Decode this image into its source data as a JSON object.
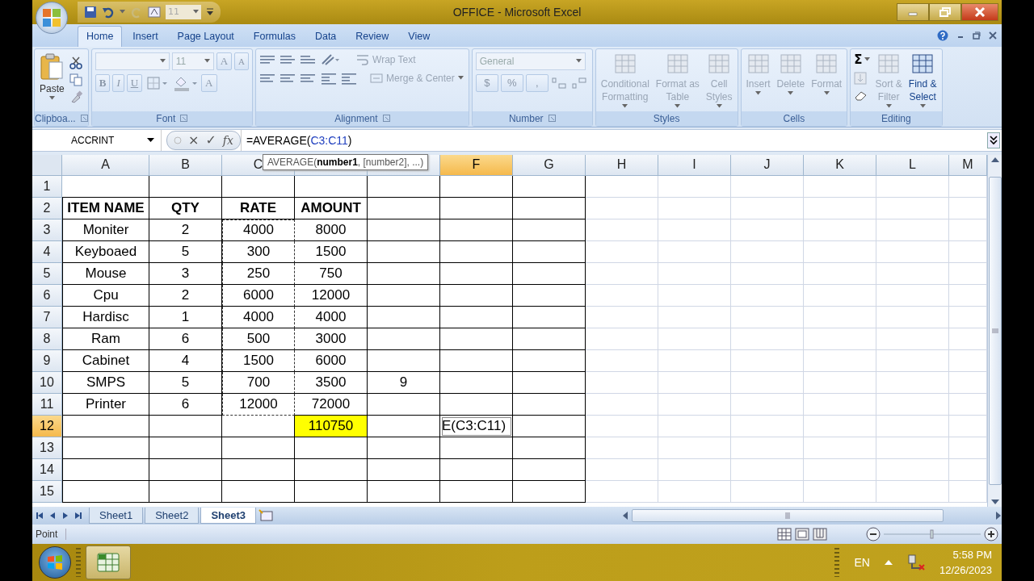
{
  "window": {
    "title": "OFFICE - Microsoft Excel"
  },
  "quick_access": {
    "font_size": "11"
  },
  "tabs": [
    {
      "label": "Home",
      "selected": true
    },
    {
      "label": "Insert",
      "selected": false
    },
    {
      "label": "Page Layout",
      "selected": false
    },
    {
      "label": "Formulas",
      "selected": false
    },
    {
      "label": "Data",
      "selected": false
    },
    {
      "label": "Review",
      "selected": false
    },
    {
      "label": "View",
      "selected": false
    }
  ],
  "ribbon": {
    "groups": [
      {
        "kind": "clipboard",
        "label": "Clipboa...",
        "commands": [
          {
            "label": "Paste",
            "disabled": false
          }
        ]
      },
      {
        "kind": "font",
        "label": "Font",
        "font_size": "11",
        "grow": "A",
        "shrink": "A",
        "styles": [
          "B",
          "I",
          "U"
        ],
        "font_color": "A"
      },
      {
        "kind": "alignment",
        "label": "Alignment",
        "commands": [
          {
            "label": "Wrap Text",
            "disabled": true
          },
          {
            "label": "Merge & Center",
            "disabled": true
          }
        ]
      },
      {
        "kind": "number",
        "label": "Number",
        "format": "General",
        "symbols": [
          "$",
          "%",
          ","
        ]
      },
      {
        "kind": "large",
        "label": "Styles",
        "commands": [
          {
            "lines": [
              "Conditional",
              "Formatting"
            ],
            "disabled": true
          },
          {
            "lines": [
              "Format as",
              "Table"
            ],
            "disabled": true
          },
          {
            "lines": [
              "Cell",
              "Styles"
            ],
            "disabled": true
          }
        ]
      },
      {
        "kind": "large",
        "label": "Cells",
        "commands": [
          {
            "lines": [
              "Insert"
            ],
            "disabled": true
          },
          {
            "lines": [
              "Delete"
            ],
            "disabled": true
          },
          {
            "lines": [
              "Format"
            ],
            "disabled": true
          }
        ]
      },
      {
        "kind": "editing",
        "label": "Editing",
        "autosum": "Σ",
        "commands": [
          {
            "lines": [
              "Sort &",
              "Filter"
            ],
            "disabled": true
          },
          {
            "lines": [
              "Find &",
              "Select"
            ],
            "disabled": false
          }
        ]
      }
    ]
  },
  "formula_bar": {
    "name_box": "ACCRINT",
    "cancel": "×",
    "enter": "✓",
    "function": "fx",
    "formula": [
      "=AVERAGE(",
      "C3:C11",
      ")"
    ]
  },
  "tooltip": "AVERAGE(**number1**, [number2], ...)",
  "sheet": {
    "columns": [
      {
        "label": "A",
        "selected": false
      },
      {
        "label": "B",
        "selected": false
      },
      {
        "label": "C",
        "selected": false
      },
      {
        "selected": false
      },
      {
        "selected": false
      },
      {
        "label": "F",
        "selected": true
      },
      {
        "label": "G",
        "selected": false
      },
      {
        "label": "H",
        "selected": false
      },
      {
        "label": "I",
        "selected": false
      },
      {
        "label": "J",
        "selected": false
      },
      {
        "label": "K",
        "selected": false
      },
      {
        "label": "L",
        "selected": false
      },
      {
        "label": "M",
        "selected": false
      }
    ],
    "rows": [
      {
        "header": "1",
        "selected": false
      },
      {
        "header": "2",
        "selected": false,
        "kind": "header",
        "cells": [
          {
            "text": "ITEM NAME"
          },
          {
            "text": "QTY"
          },
          {
            "text": "RATE"
          },
          {
            "text": "AMOUNT"
          }
        ]
      },
      {
        "header": "3",
        "selected": false,
        "cells": [
          {
            "text": "Moniter"
          },
          {
            "text": "2"
          },
          {
            "text": "4000",
            "kind": "reference"
          },
          {
            "text": "8000"
          }
        ]
      },
      {
        "header": "4",
        "selected": false,
        "cells": [
          {
            "text": "Keyboaed"
          },
          {
            "text": "5"
          },
          {
            "text": "300",
            "kind": "reference"
          },
          {
            "text": "1500"
          }
        ]
      },
      {
        "header": "5",
        "selected": false,
        "cells": [
          {
            "text": "Mouse"
          },
          {
            "text": "3"
          },
          {
            "text": "250",
            "kind": "reference"
          },
          {
            "text": "750"
          }
        ]
      },
      {
        "header": "6",
        "selected": false,
        "cells": [
          {
            "text": "Cpu"
          },
          {
            "text": "2"
          },
          {
            "text": "6000",
            "kind": "reference"
          },
          {
            "text": "12000"
          }
        ]
      },
      {
        "header": "7",
        "selected": false,
        "cells": [
          {
            "text": "Hardisc"
          },
          {
            "text": "1"
          },
          {
            "text": "4000",
            "kind": "reference"
          },
          {
            "text": "4000"
          }
        ]
      },
      {
        "header": "8",
        "selected": false,
        "cells": [
          {
            "text": "Ram"
          },
          {
            "text": "6"
          },
          {
            "text": "500",
            "kind": "reference"
          },
          {
            "text": "3000"
          }
        ]
      },
      {
        "header": "9",
        "selected": false,
        "cells": [
          {
            "text": "Cabinet"
          },
          {
            "text": "4"
          },
          {
            "text": "1500",
            "kind": "reference"
          },
          {
            "text": "6000"
          }
        ]
      },
      {
        "header": "10",
        "selected": false,
        "cells": [
          {
            "text": "SMPS"
          },
          {
            "text": "5"
          },
          {
            "text": "700",
            "kind": "reference"
          },
          {
            "text": "3500"
          },
          {
            "text": "9"
          }
        ]
      },
      {
        "header": "11",
        "selected": false,
        "cells": [
          {
            "text": "Printer"
          },
          {
            "text": "6"
          },
          {
            "text": "12000",
            "kind": "reference"
          },
          {
            "text": "72000"
          }
        ]
      },
      {
        "header": "12",
        "selected": true,
        "cells": [
          {},
          {},
          {},
          {
            "text": "110750",
            "color": "#ffff00"
          },
          {},
          {
            "text": "E(C3:C11)",
            "kind": "editing"
          }
        ]
      },
      {
        "header": "13",
        "selected": false
      },
      {
        "header": "14",
        "selected": false
      },
      {
        "header": "15",
        "selected": false
      }
    ]
  },
  "sheet_tabs": [
    {
      "label": "Sheet1",
      "selected": false
    },
    {
      "label": "Sheet2",
      "selected": false
    },
    {
      "label": "Sheet3",
      "selected": true
    }
  ],
  "status_bar": {
    "mode": "Point"
  },
  "taskbar": {
    "language": "EN",
    "time": "5:58 PM",
    "date": "12/26/2023"
  }
}
